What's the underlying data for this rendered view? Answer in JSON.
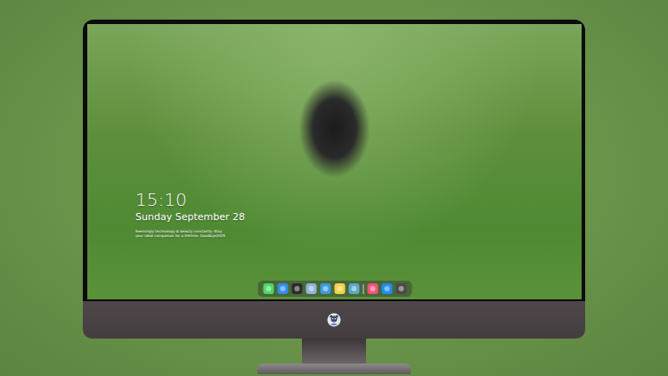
{
  "lock_screen": {
    "time": "15:10",
    "date": "Sunday September 28",
    "caption": [
      "Seemingly technology & beauty constantly. Stay",
      "your ideal companion for a lifetime. Goodbye2025"
    ]
  },
  "dock": {
    "items": [
      {
        "kind": "app",
        "color": "#4cd964"
      },
      {
        "kind": "app",
        "color": "#2f8cf0"
      },
      {
        "kind": "app",
        "color": "#2b2b2b"
      },
      {
        "kind": "app",
        "color": "#8fb6d8"
      },
      {
        "kind": "app",
        "color": "#3a9bd9"
      },
      {
        "kind": "app",
        "color": "#f7d14a"
      },
      {
        "kind": "app",
        "color": "#5aa9c9"
      },
      {
        "kind": "separator",
        "color": "#cfcfcf"
      },
      {
        "kind": "app",
        "color": "#f2547a"
      },
      {
        "kind": "app",
        "color": "#1f8ef1"
      },
      {
        "kind": "app",
        "color": "#4a4a4a"
      }
    ]
  }
}
